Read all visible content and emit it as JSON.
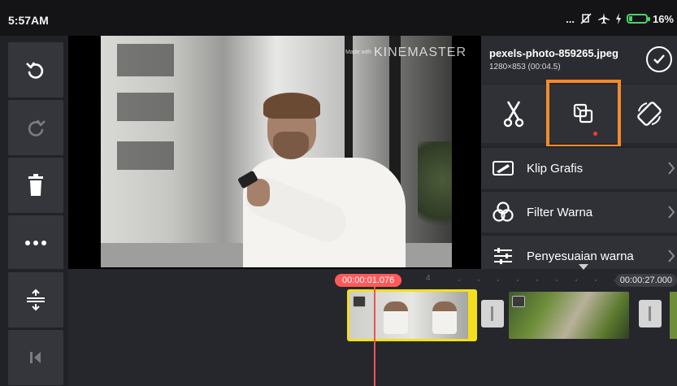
{
  "status_bar": {
    "time": "5:57AM",
    "dots": "...",
    "battery": "16%"
  },
  "left_toolbar": {
    "buttons": [
      {
        "name": "undo",
        "icon": "undo-icon",
        "enabled": true
      },
      {
        "name": "redo",
        "icon": "redo-icon",
        "enabled": false
      },
      {
        "name": "delete",
        "icon": "trash-icon",
        "enabled": true
      },
      {
        "name": "more",
        "icon": "more-icon",
        "enabled": true
      }
    ],
    "timeline_buttons": [
      {
        "name": "expand-timeline",
        "icon": "expand-icon",
        "enabled": true
      },
      {
        "name": "go-to-start",
        "icon": "skip-start-icon",
        "enabled": false
      }
    ]
  },
  "preview": {
    "watermark_small": "Made with",
    "watermark": "KINEMASTER"
  },
  "panel": {
    "file_name": "pexels-photo-859265.jpeg",
    "file_meta": "1280×853 (00:04.5)",
    "tools": [
      {
        "name": "split",
        "icon": "scissors-icon"
      },
      {
        "name": "crop",
        "icon": "crop-icon",
        "selected": true
      },
      {
        "name": "rotate",
        "icon": "rotate-icon"
      }
    ],
    "menu": [
      {
        "label": "Klip Grafis",
        "icon": "clip-graphics-icon"
      },
      {
        "label": "Filter Warna",
        "icon": "color-filter-icon"
      },
      {
        "label": "Penyesuaian warna",
        "icon": "color-adjust-icon"
      }
    ]
  },
  "timeline": {
    "current_time": "00:00:01.076",
    "end_time": "00:00:27.000",
    "tick_label": "4"
  },
  "colors": {
    "highlight": "#f28a2e",
    "playhead": "#ff5a5a",
    "clip_selected": "#f3df1c"
  }
}
